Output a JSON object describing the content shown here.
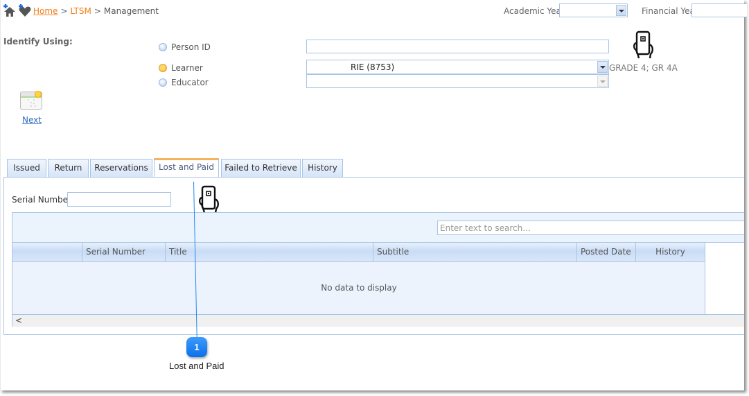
{
  "breadcrumb": {
    "home": "Home",
    "section": "LTSM",
    "page": "Management",
    "separator": ">"
  },
  "header": {
    "academic_year_label": "Academic Year",
    "academic_year_value": "",
    "financial_year_label": "Financial Year",
    "financial_year_value": ""
  },
  "identify": {
    "label": "Identify Using:",
    "options": [
      {
        "label": "Person ID",
        "checked": false
      },
      {
        "label": "Learner",
        "checked": true
      },
      {
        "label": "Educator",
        "checked": false
      }
    ],
    "person_id_value": "",
    "learner_value": "RIE (8753)",
    "educator_value": "",
    "learner_grade": "GRADE 4; GR 4A"
  },
  "next_label": "Next",
  "tabs": [
    {
      "label": "Issued",
      "active": false
    },
    {
      "label": "Return",
      "active": false
    },
    {
      "label": "Reservations",
      "active": false
    },
    {
      "label": "Lost and Paid",
      "active": true
    },
    {
      "label": "Failed to Retrieve",
      "active": false
    },
    {
      "label": "History",
      "active": false
    }
  ],
  "panel": {
    "serial_number_label": "Serial Number",
    "serial_number_value": "",
    "search_placeholder": "Enter text to search...",
    "columns": [
      "",
      "Serial Number",
      "Title",
      "Subtitle",
      "Posted Date",
      "History"
    ],
    "empty_text": "No data to display",
    "scroll_left": "<"
  },
  "callout": {
    "number": "1",
    "label": "Lost and Paid",
    "color": "#1a7ff0"
  },
  "colors": {
    "accent_orange": "#f07d1b",
    "border_blue": "#a8c4e5",
    "active_tab": "#f4b35e",
    "link": "#2e6ebc"
  }
}
